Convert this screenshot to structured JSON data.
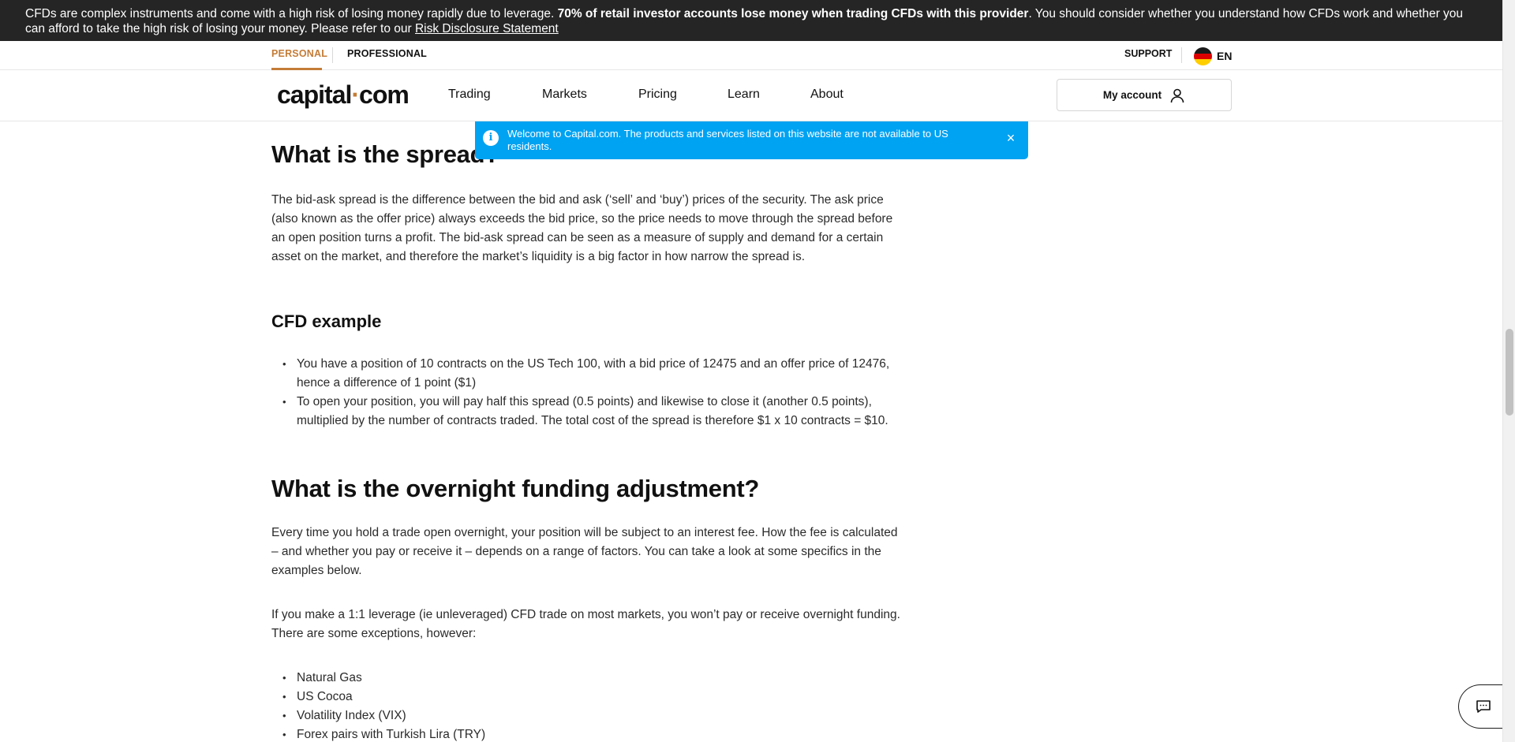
{
  "risk_banner": {
    "text_1": "CFDs are complex instruments and come with a high risk of losing money rapidly due to leverage.",
    "bold": "70% of retail investor accounts lose money when trading CFDs with this provider",
    "text_2": ". You should consider whether you understand how CFDs work and whether you can afford to take the high risk of losing your money. Please refer to our",
    "link": "Risk Disclosure Statement"
  },
  "top_bar": {
    "personal": "PERSONAL",
    "professional": "PROFESSIONAL",
    "support": "SUPPORT",
    "language": "EN"
  },
  "nav": {
    "logo_left": "capital",
    "logo_dot": "·",
    "logo_right": "com",
    "items": [
      "Trading",
      "Markets",
      "Pricing",
      "Learn",
      "About"
    ],
    "account": "My account"
  },
  "notice": {
    "icon": "i",
    "text": "Welcome to Capital.com. The products and services listed on this website are not available to US residents.",
    "close": "×"
  },
  "article": {
    "h_spread": "What is the spread?",
    "p_spread": "The bid-ask spread is the difference between the bid and ask (‘sell’ and ‘buy’) prices of the security. The ask price (also known as the offer price) always exceeds the bid price, so the price needs to move through the spread before an open position turns a profit. The bid-ask spread can be seen as a measure of supply and demand for a certain asset on the market, and therefore the market’s liquidity is a big factor in how narrow the spread is.",
    "h_cfd": "CFD example",
    "cfd_items": [
      "You have a position of 10 contracts on the US Tech 100, with a bid price of 12475 and an offer price of 12476, hence a difference of 1 point ($1)",
      "To open your position, you will pay half this spread (0.5 points) and likewise to close it (another 0.5 points), multiplied by the number of contracts traded. The total cost of the spread is therefore $1 x 10 contracts = $10."
    ],
    "h_overnight": "What is the overnight funding adjustment?",
    "p_overnight_1": "Every time you hold a trade open overnight, your position will be subject to an interest fee. How the fee is calculated – and whether you pay or receive it – depends on a range of factors. You can take a look at some specifics in the examples below.",
    "p_overnight_2": "If you make a 1:1 leverage (ie unleveraged) CFD trade on most markets, you won’t pay or receive overnight funding. There are some exceptions, however:",
    "exceptions": [
      "Natural Gas",
      "US Cocoa",
      "Volatility Index (VIX)",
      "Forex pairs with Turkish Lira (TRY)"
    ]
  },
  "colors": {
    "accent": "#c47c37",
    "notice_bg": "#00a2f2",
    "banner_bg": "#252525"
  },
  "icons": {
    "account": "user-icon",
    "notice": "info-icon",
    "close": "close-icon",
    "chat": "chat-icon",
    "flag": "germany-flag-icon"
  }
}
